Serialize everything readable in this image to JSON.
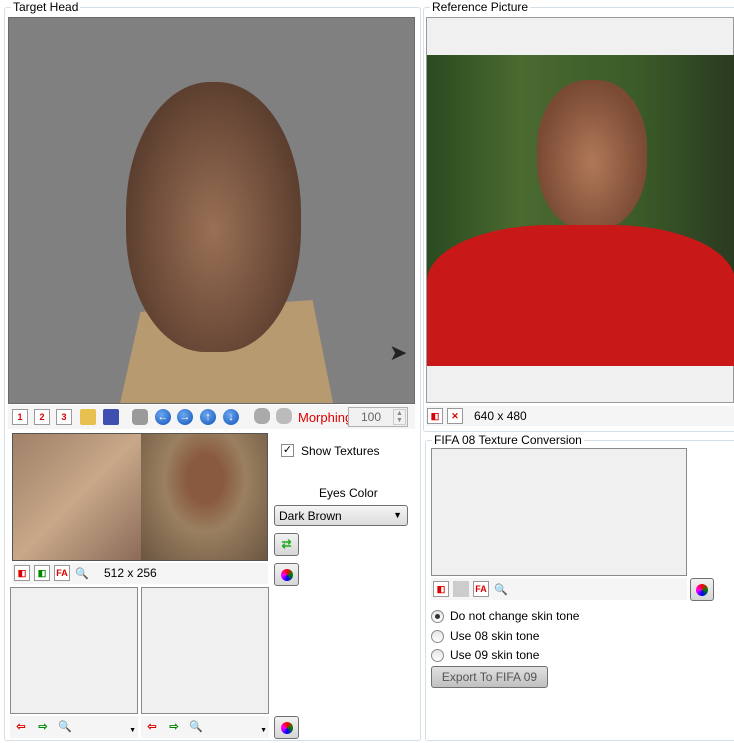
{
  "target_head": {
    "title": "Target Head",
    "toolbar": {
      "icons": [
        "new-1-icon",
        "new-2-icon",
        "new-3-icon",
        "open-folder-icon",
        "save-icon",
        "hand-icon",
        "arrow-left-icon",
        "arrow-right-icon",
        "arrow-up-icon",
        "arrow-down-icon",
        "head-icon",
        "head-textured-icon"
      ],
      "morphing_label": "Morphing",
      "morphing_value": "100"
    },
    "texture": {
      "size": "512 x 256",
      "show_textures_label": "Show Textures",
      "show_textures_checked": true,
      "eyes_color_label": "Eyes Color",
      "eyes_color_value": "Dark Brown"
    }
  },
  "reference_picture": {
    "title": "Reference Picture",
    "size": "640 x 480"
  },
  "fifa08": {
    "title": "FIFA 08 Texture Conversion",
    "options": [
      "Do not change skin tone",
      "Use 08 skin tone",
      "Use 09 skin tone"
    ],
    "selected": 0,
    "export_label": "Export To FIFA 09"
  },
  "colors": {
    "viewport": "#808080",
    "morphing": "#e00000"
  }
}
